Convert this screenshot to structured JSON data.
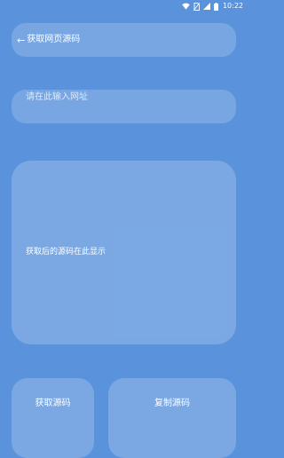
{
  "status_bar": {
    "time": "10:22",
    "icons": [
      "wifi-icon",
      "sim-off-icon",
      "signal-icon",
      "battery-icon"
    ]
  },
  "header": {
    "back_icon": "back-arrow-icon",
    "back_glyph": "←",
    "title": "获取网页源码"
  },
  "url_input": {
    "placeholder": "请在此输入网址",
    "value": ""
  },
  "source_area": {
    "placeholder": "获取后的源码在此显示"
  },
  "buttons": {
    "fetch_label": "获取源码",
    "copy_label": "复制源码"
  },
  "colors": {
    "background": "#5a93dc",
    "card": "rgba(255,255,255,0.18)",
    "text": "#ffffff"
  }
}
